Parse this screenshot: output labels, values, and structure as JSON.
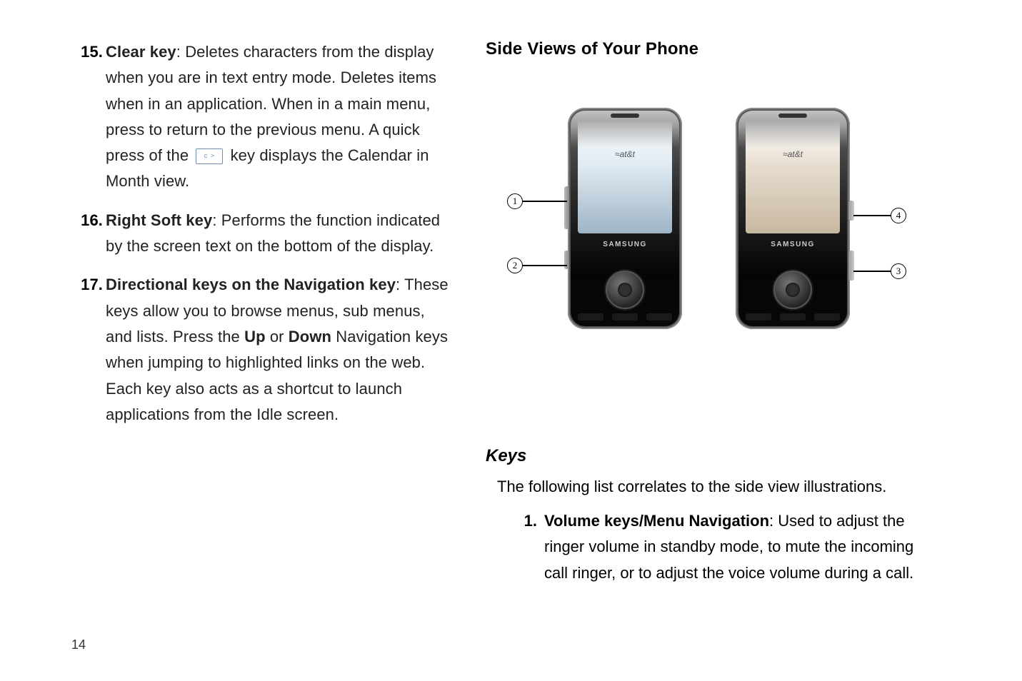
{
  "page_number": "14",
  "left_items": [
    {
      "num": "15.",
      "title": "Clear key",
      "text_before_icon": ": Deletes characters from the display when you are in text entry mode. Deletes items when in an application. When in a main menu, press to return to the previous menu. A quick press of the ",
      "text_after_icon": " key displays the Calendar in Month view."
    },
    {
      "num": "16.",
      "title": "Right Soft key",
      "text": ": Performs the function indicated by the screen text on the bottom of the display."
    },
    {
      "num": "17.",
      "title": "Directional keys on the Navigation key",
      "text_a": ": These keys allow you to browse menus, sub menus, and lists. Press the ",
      "bold_a": "Up",
      "text_b": " or ",
      "bold_b": "Down",
      "text_c": " Navigation keys when jumping to highlighted links on the web. Each key also acts as a shortcut to launch applications from the Idle screen."
    }
  ],
  "right": {
    "heading": "Side Views of Your Phone",
    "phone_logo": "at&t",
    "phone_brand": "SAMSUNG",
    "callouts": {
      "c1": "1",
      "c2": "2",
      "c3": "3",
      "c4": "4"
    },
    "sub_heading": "Keys",
    "intro": "The following list correlates to the side view illustrations.",
    "item1": {
      "num": "1.",
      "title": "Volume keys/Menu Navigation",
      "text": ": Used to adjust the ringer volume in standby mode, to mute the incoming call ringer, or to adjust the voice volume during a call."
    }
  }
}
